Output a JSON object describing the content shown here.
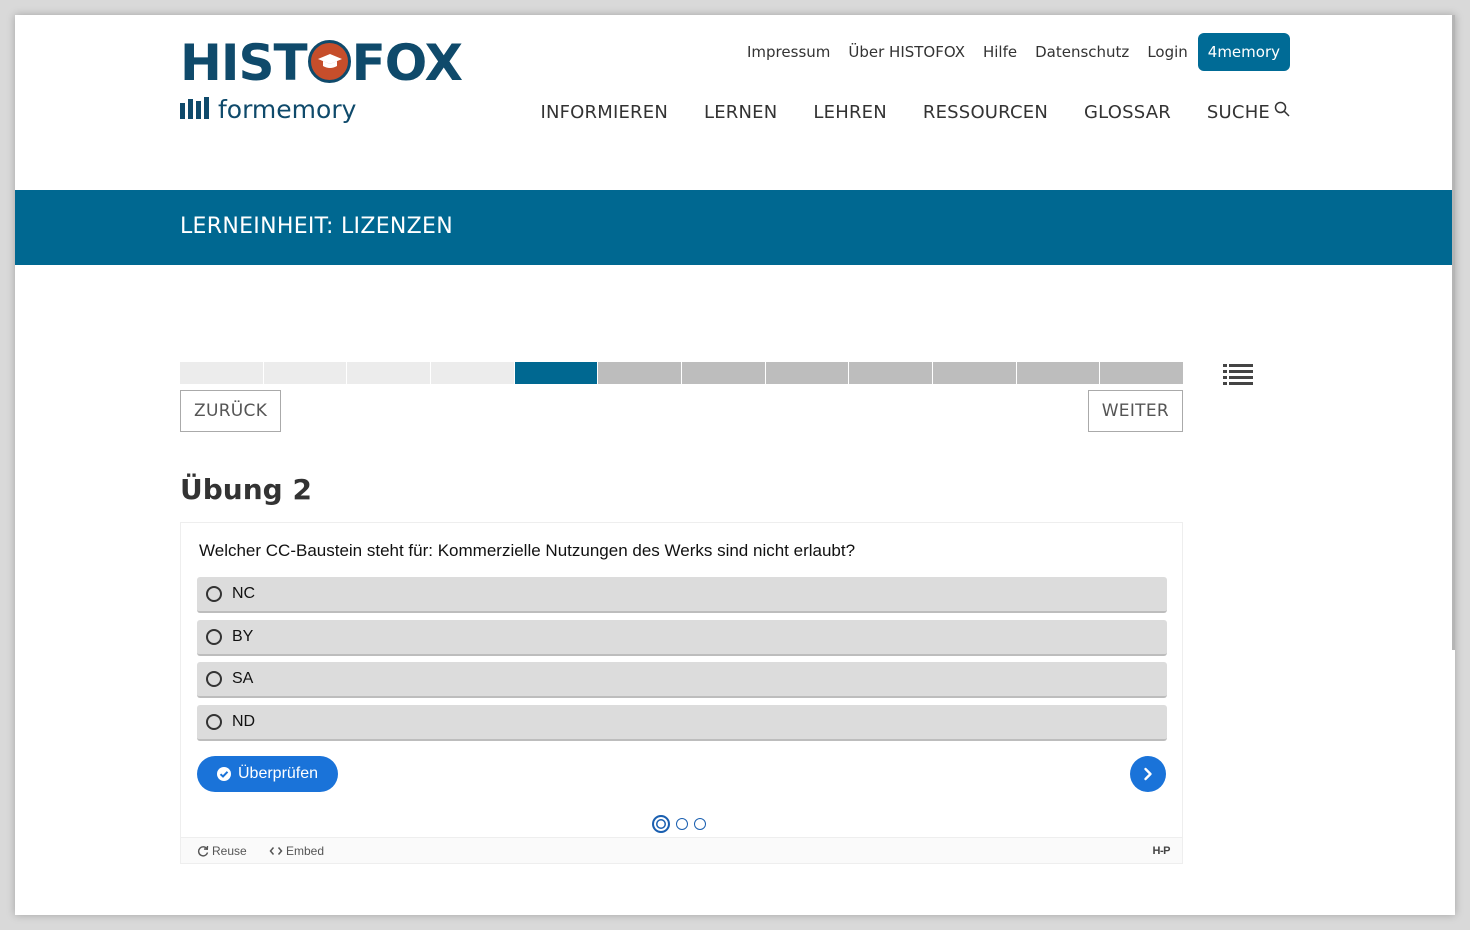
{
  "logo": {
    "left_text": "HIST",
    "right_text": "FOX",
    "sub_text": "formemory"
  },
  "topnav": {
    "impressum": "Impressum",
    "ueber": "Über HISTOFOX",
    "hilfe": "Hilfe",
    "datenschutz": "Datenschutz",
    "login": "Login",
    "memory": "4memory"
  },
  "mainnav": {
    "informieren": "INFORMIEREN",
    "lernen": "LERNEN",
    "lehren": "LEHREN",
    "ressourcen": "RESSOURCEN",
    "glossar": "GLOSSAR",
    "suche": "SUCHE"
  },
  "banner": {
    "title": "LERNEINHEIT: LIZENZEN"
  },
  "progress": {
    "total_steps": 12,
    "current_step": 5
  },
  "buttons": {
    "back": "ZURÜCK",
    "next": "WEITER"
  },
  "exercise": {
    "title": "Übung 2",
    "question": "Welcher CC-Baustein steht für: Kommerzielle Nutzungen des Werks sind nicht erlaubt?",
    "answers": [
      "NC",
      "BY",
      "SA",
      "ND"
    ],
    "check_label": "Überprüfen",
    "pages": 3,
    "active_page": 1
  },
  "footer": {
    "reuse": "Reuse",
    "embed": "Embed",
    "h5p": "H-P"
  },
  "colors": {
    "brand_dark": "#0f4a6b",
    "brand_accent": "#c64e2b",
    "banner": "#006891",
    "h5p_blue": "#1a73d9"
  }
}
